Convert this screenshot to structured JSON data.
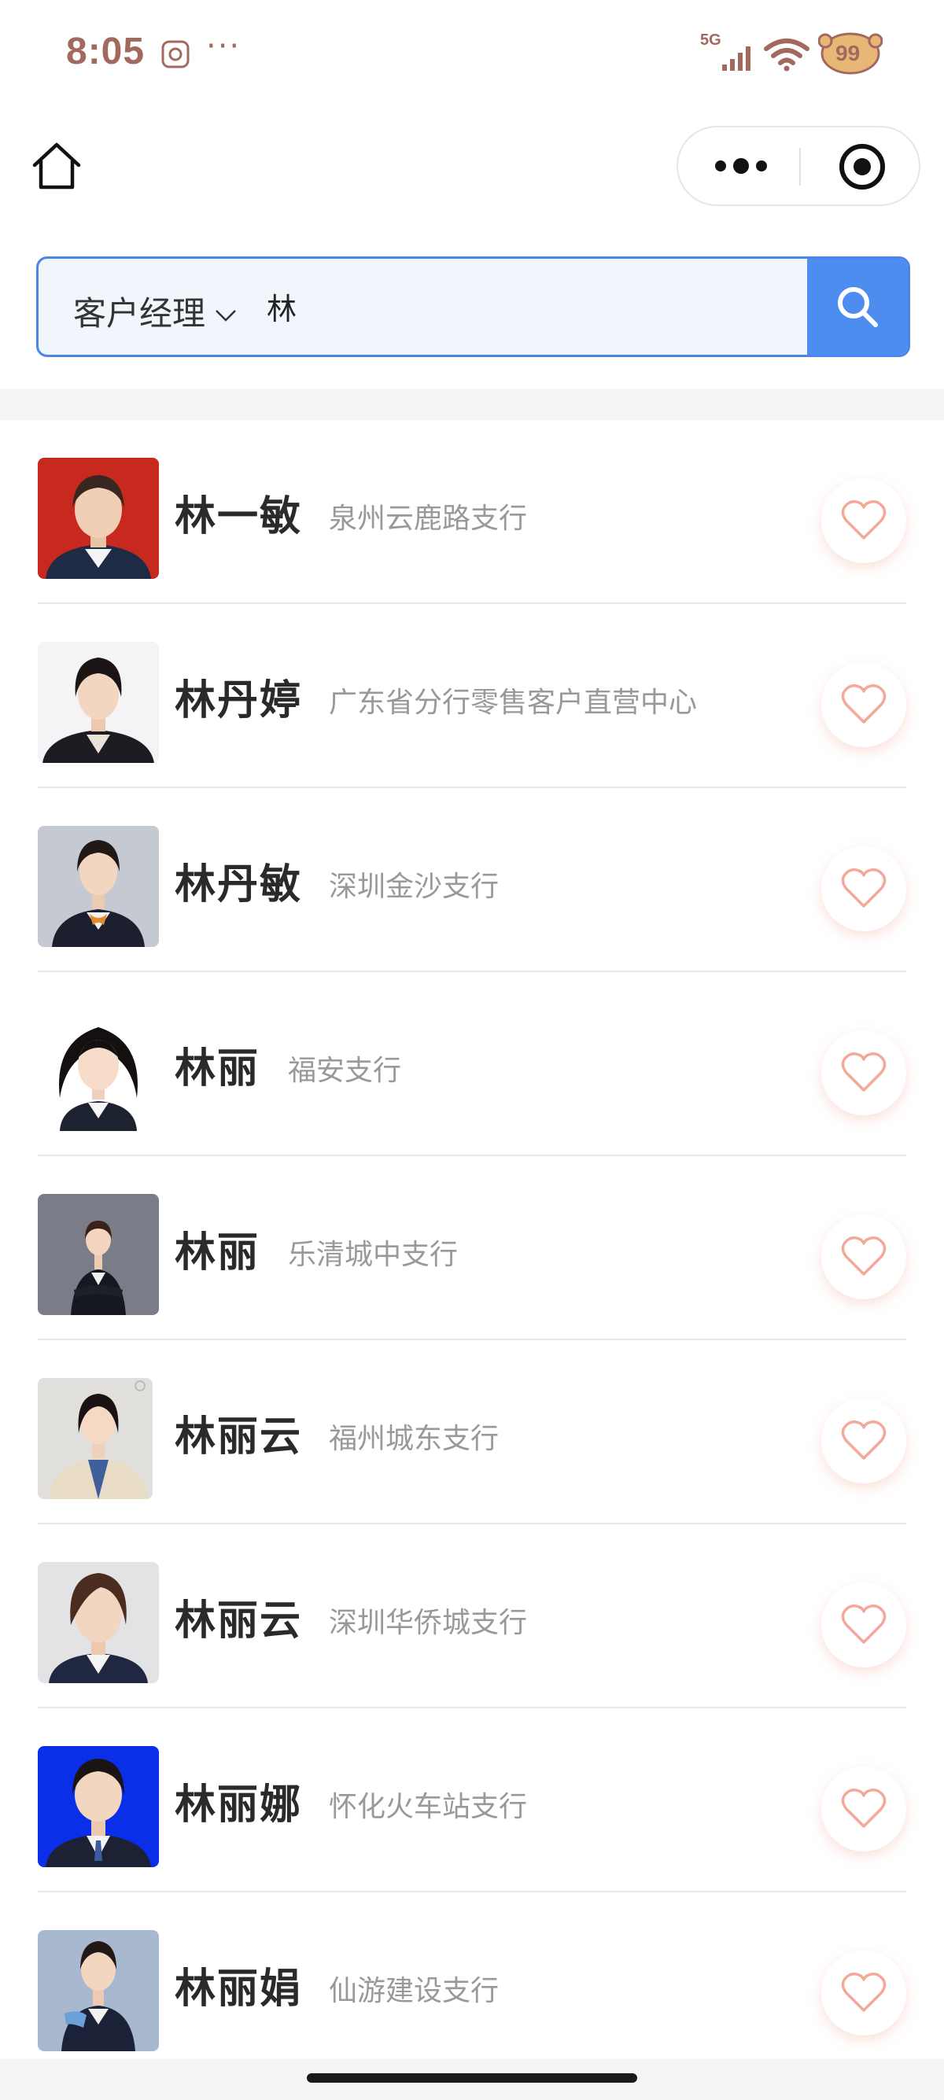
{
  "status_bar": {
    "time": "8:05",
    "more": "···",
    "network": "5G",
    "battery_text": "99"
  },
  "search": {
    "type_label": "客户经理",
    "query": "林"
  },
  "colors": {
    "accent_blue": "#4d8def",
    "status_text": "#a26a5f",
    "heart": "#f2a99a"
  },
  "managers": [
    {
      "name": "林一敏",
      "branch": "泉州云鹿路支行",
      "avatar_bg": "#c8291f"
    },
    {
      "name": "林丹婷",
      "branch": "广东省分行零售客户直营中心",
      "avatar_bg": "#f4f4f6"
    },
    {
      "name": "林丹敏",
      "branch": "深圳金沙支行",
      "avatar_bg": "#c5c9d2"
    },
    {
      "name": "林丽",
      "branch": "福安支行",
      "avatar_bg": "#ffffff"
    },
    {
      "name": "林丽",
      "branch": "乐清城中支行",
      "avatar_bg": "#7a7c88"
    },
    {
      "name": "林丽云",
      "branch": "福州城东支行",
      "avatar_bg": "#e1dfdb"
    },
    {
      "name": "林丽云",
      "branch": "深圳华侨城支行",
      "avatar_bg": "#e3e3e6"
    },
    {
      "name": "林丽娜",
      "branch": "怀化火车站支行",
      "avatar_bg": "#0b2ee8"
    },
    {
      "name": "林丽娟",
      "branch": "仙游建设支行",
      "avatar_bg": "#a8b8cf"
    }
  ]
}
